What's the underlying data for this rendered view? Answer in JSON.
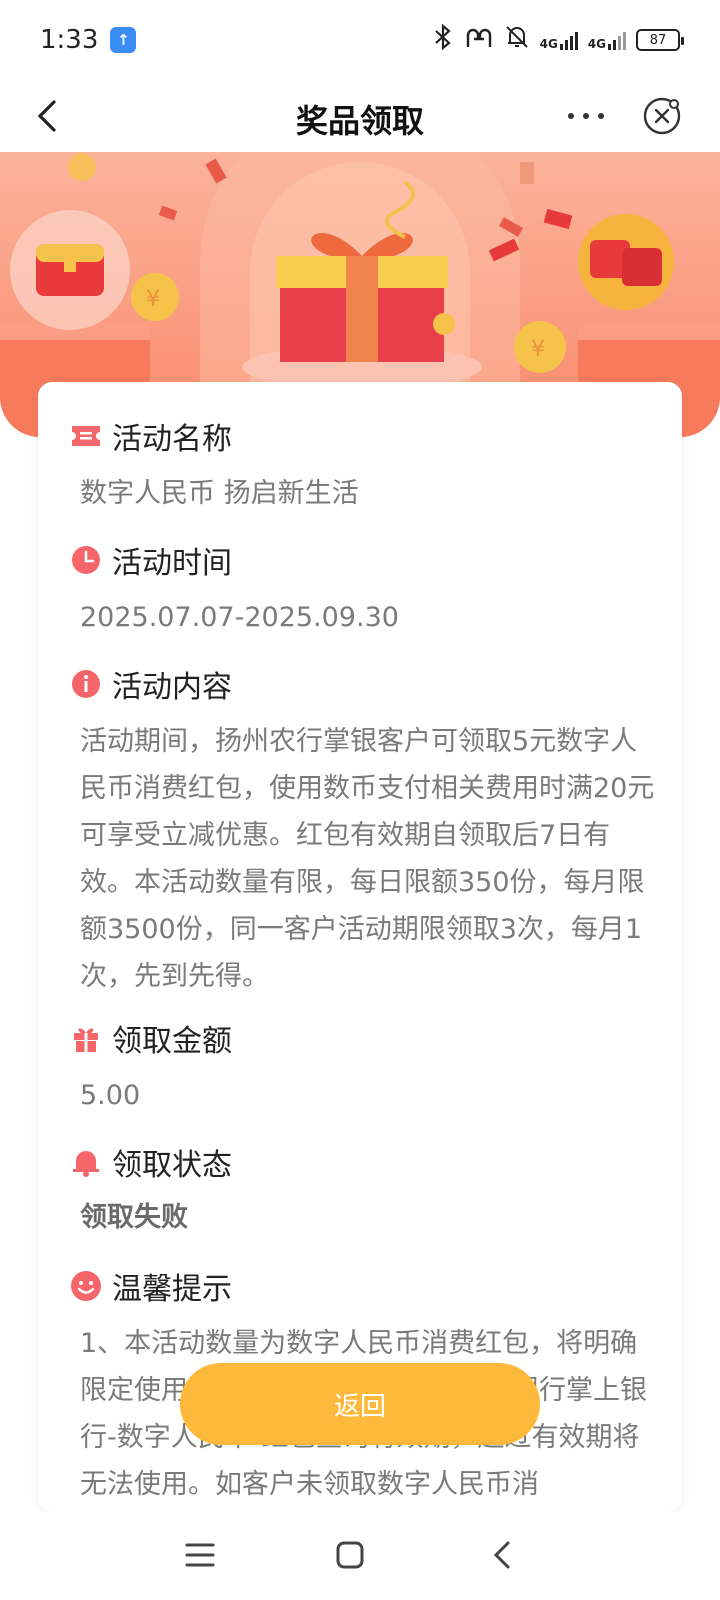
{
  "status_bar": {
    "time": "1:33",
    "app_icon_glyph": "↑",
    "network_1": "4G",
    "network_2": "4G",
    "battery": "87"
  },
  "nav": {
    "title": "奖品领取"
  },
  "sections": [
    {
      "title": "活动名称",
      "value": "数字人民币 扬启新生活",
      "icon": "ticket-icon"
    },
    {
      "title": "活动时间",
      "value": "2025.07.07-2025.09.30",
      "icon": "clock-icon"
    },
    {
      "title": "活动内容",
      "value": "活动期间，扬州农行掌银客户可领取5元数字人民币消费红包，使用数币支付相关费用时满20元可享受立减优惠。红包有效期自领取后7日有效。本活动数量有限，每日限额350份，每月限额3500份，同一客户活动期限领取3次，每月1次，先到先得。",
      "icon": "info-icon"
    },
    {
      "title": "领取金额",
      "value": "5.00",
      "icon": "gift-icon"
    },
    {
      "title": "领取状态",
      "value": "领取失败",
      "icon": "bell-icon"
    },
    {
      "title": "温馨提示",
      "value": "1、本活动数量为数字人民币消费红包，将明确限定使用范围，客户可通过中国农业银行掌上银行-数字人民币-红包查询有效期，超过有效期将无法使用。如客户未领取数字人民币消",
      "icon": "smile-icon"
    }
  ],
  "return_button": "返回",
  "colors": {
    "accent_red": "#f5666a",
    "button_yellow": "#fcb93b",
    "banner_orange": "#fa9d82"
  }
}
